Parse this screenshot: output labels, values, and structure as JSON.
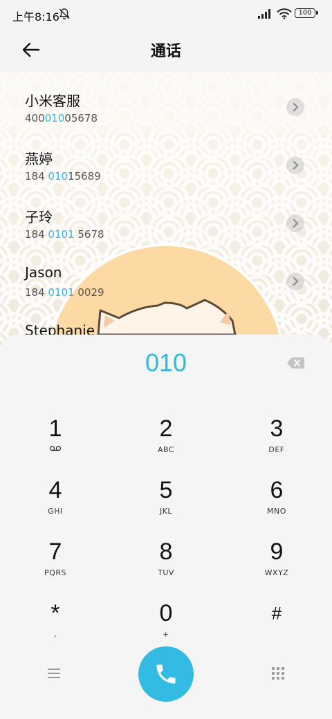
{
  "status_bar": {
    "time": "上午8:16",
    "battery": "100"
  },
  "header": {
    "title": "通话"
  },
  "contacts": [
    {
      "name": "小米客服",
      "num_pre": "400",
      "num_hl": "010",
      "num_post": "05678"
    },
    {
      "name": "燕婷",
      "num_pre": "184 ",
      "num_hl": "010",
      "num_post": "15689"
    },
    {
      "name": "子玲",
      "num_pre": "184 ",
      "num_hl": "0101",
      "num_post": " 5678"
    },
    {
      "name": "Jason",
      "num_pre": "184 ",
      "num_hl": "0101",
      "num_post": " 0029"
    },
    {
      "name": "Stephanie",
      "num_pre": "",
      "num_hl": "",
      "num_post": ""
    }
  ],
  "dialer": {
    "input": "010",
    "keys": [
      {
        "digit": "1",
        "letters": ""
      },
      {
        "digit": "2",
        "letters": "ABC"
      },
      {
        "digit": "3",
        "letters": "DEF"
      },
      {
        "digit": "4",
        "letters": "GHI"
      },
      {
        "digit": "5",
        "letters": "JKL"
      },
      {
        "digit": "6",
        "letters": "MNO"
      },
      {
        "digit": "7",
        "letters": "PQRS"
      },
      {
        "digit": "8",
        "letters": "TUV"
      },
      {
        "digit": "9",
        "letters": "WXYZ"
      },
      {
        "digit": "*",
        "letters": ","
      },
      {
        "digit": "0",
        "letters": "+"
      },
      {
        "digit": "#",
        "letters": ""
      }
    ]
  },
  "colors": {
    "accent": "#31b7e0",
    "call_button": "#33bbe3"
  },
  "icons": {
    "back": "arrow-left-icon",
    "mute": "bell-off-icon",
    "signal": "signal-icon",
    "wifi": "wifi-icon",
    "voicemail": "voicemail-icon",
    "backspace": "backspace-icon",
    "menu": "menu-icon",
    "call": "phone-icon",
    "keypad": "keypad-icon"
  }
}
